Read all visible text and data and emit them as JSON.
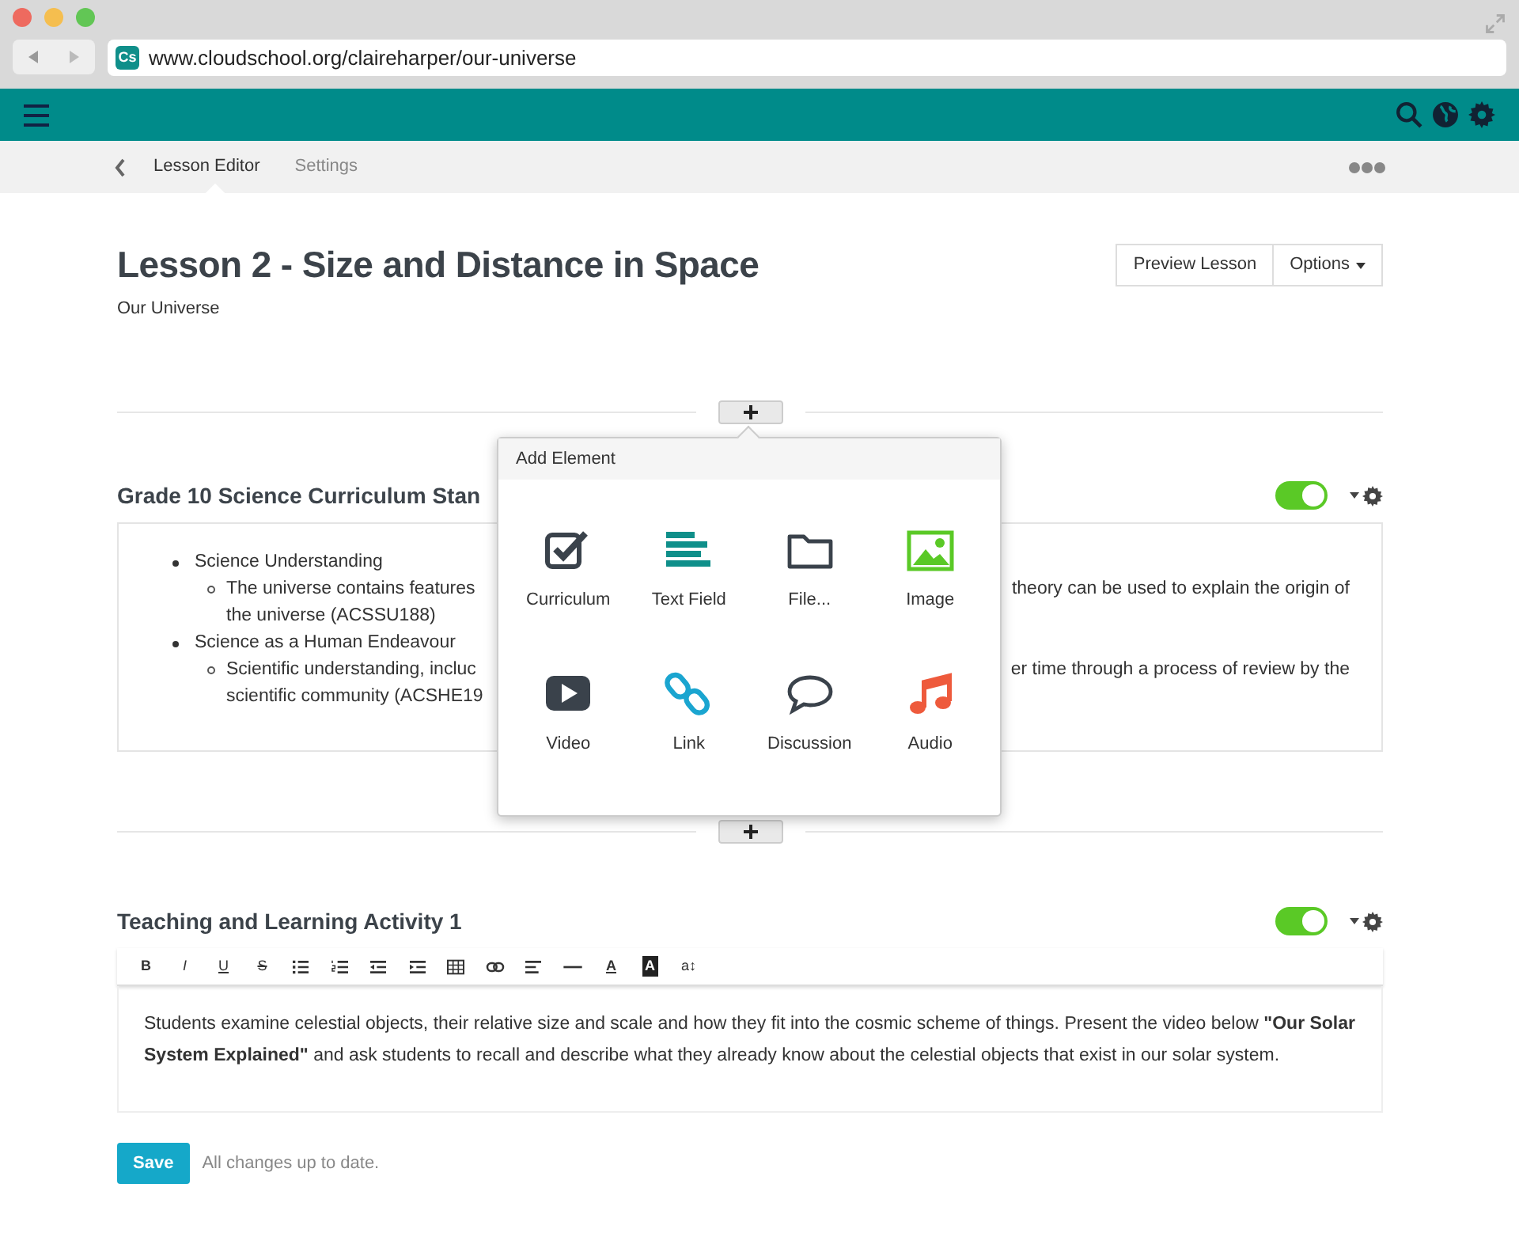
{
  "browser": {
    "url": "www.cloudschool.org/claireharper/our-universe",
    "favicon": "Cs"
  },
  "subnav": {
    "tabs": [
      {
        "label": "Lesson Editor",
        "selected": true
      },
      {
        "label": "Settings",
        "selected": false
      }
    ]
  },
  "lesson": {
    "title": "Lesson 2 - Size and Distance in Space",
    "subtitle": "Our Universe",
    "buttons": [
      "Preview Lesson",
      "Options"
    ]
  },
  "add_element_menu": {
    "title": "Add Element",
    "items": [
      {
        "kind": "curriculum",
        "label": "Curriculum"
      },
      {
        "kind": "text",
        "label": "Text Field"
      },
      {
        "kind": "file",
        "label": "File..."
      },
      {
        "kind": "image",
        "label": "Image"
      },
      {
        "kind": "video",
        "label": "Video"
      },
      {
        "kind": "link",
        "label": "Link"
      },
      {
        "kind": "discussion",
        "label": "Discussion"
      },
      {
        "kind": "audio",
        "label": "Audio"
      }
    ]
  },
  "sections": [
    {
      "kind": "curriculum",
      "title": "Grade 10 Science Curriculum Stan",
      "on": true,
      "items": [
        {
          "text": "Science Understanding",
          "children": [
            {
              "lines": [
                [
                  "The universe contains features",
                  "theory can be used to explain the origin of"
                ],
                [
                  "the universe (ACSSU188)"
                ]
              ]
            }
          ]
        },
        {
          "text": "Science as a Human Endeavour",
          "children": [
            {
              "lines": [
                [
                  "Scientific understanding, incluc",
                  "er time through a process of review by the"
                ],
                [
                  "scientific community (ACSHE19"
                ]
              ]
            }
          ]
        }
      ]
    },
    {
      "kind": "text",
      "title": "Teaching and Learning Activity 1",
      "on": true,
      "toolbar": [
        {
          "kind": "bold",
          "label": "B"
        },
        {
          "kind": "italic",
          "label": "I"
        },
        {
          "kind": "underline",
          "label": "U"
        },
        {
          "kind": "strike",
          "label": "S"
        },
        {
          "kind": "bullets"
        },
        {
          "kind": "numbers"
        },
        {
          "kind": "outdent"
        },
        {
          "kind": "indent"
        },
        {
          "kind": "table"
        },
        {
          "kind": "link"
        },
        {
          "kind": "align"
        },
        {
          "kind": "rule"
        },
        {
          "kind": "color",
          "label": "A"
        },
        {
          "kind": "highlight",
          "label": "A"
        },
        {
          "kind": "size",
          "label": "a↕"
        }
      ],
      "body": "Students examine celestial objects, their relative size and scale and how they fit into the cosmic scheme of things. Present the video below **\"Our Solar System Explained\"** and ask students to recall and describe what they already know about the celestial objects that exist in our solar system."
    }
  ],
  "footer": {
    "save": "Save",
    "status": "All changes up to date."
  }
}
